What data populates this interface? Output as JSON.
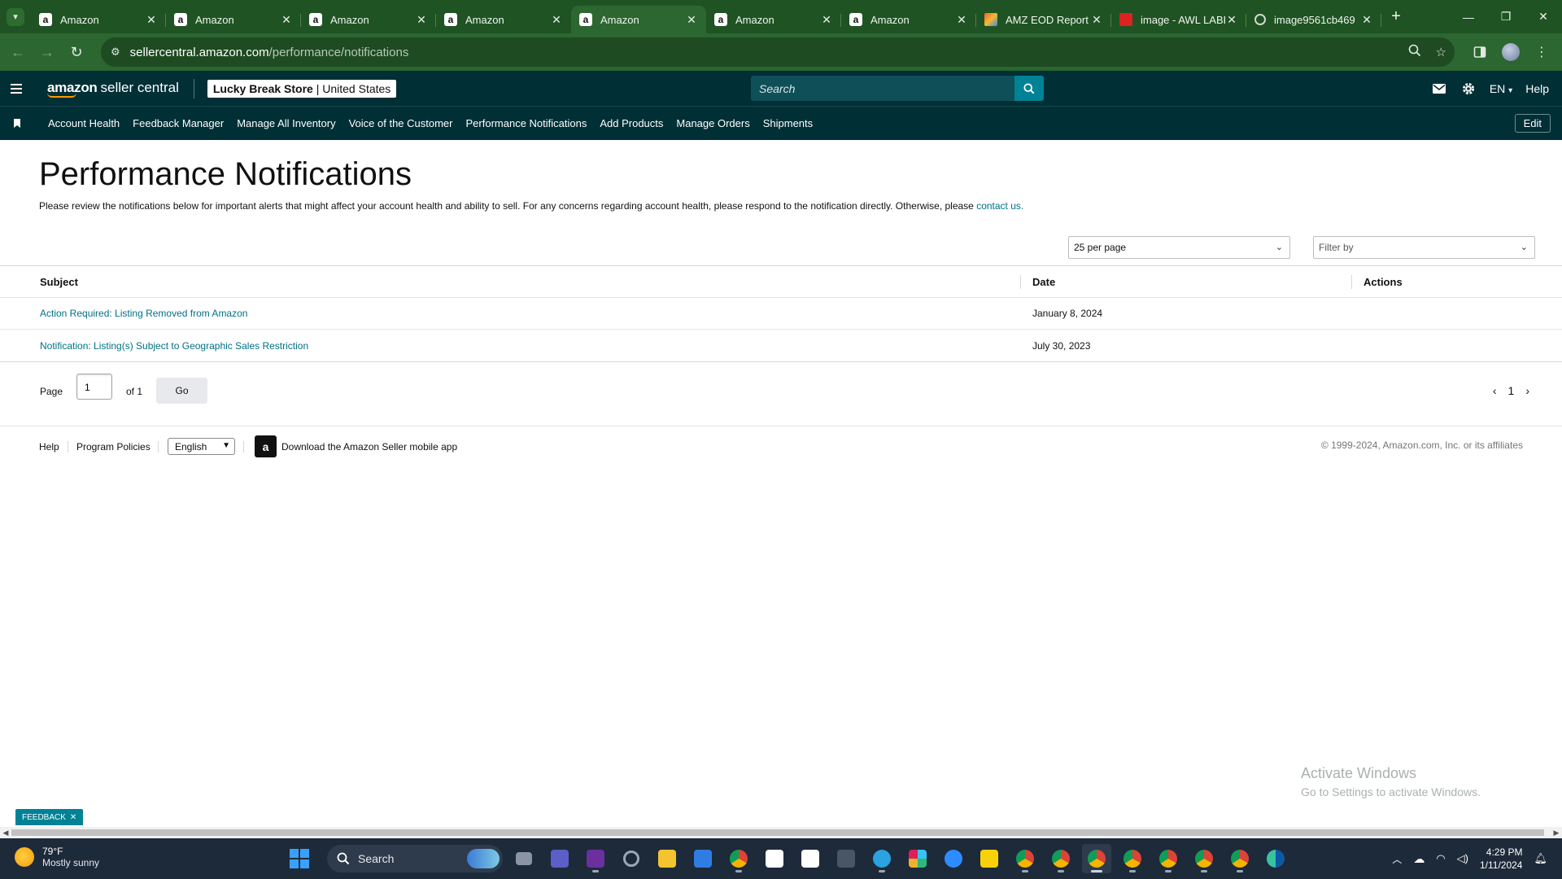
{
  "browser": {
    "tabs": [
      {
        "title": "Amazon",
        "favicon": "amazon-icon",
        "active": false
      },
      {
        "title": "Amazon",
        "favicon": "amazon-icon",
        "active": false
      },
      {
        "title": "Amazon",
        "favicon": "amazon-icon",
        "active": false
      },
      {
        "title": "Amazon",
        "favicon": "amazon-icon",
        "active": false
      },
      {
        "title": "Amazon",
        "favicon": "amazon-icon",
        "active": true
      },
      {
        "title": "Amazon",
        "favicon": "amazon-icon",
        "active": false
      },
      {
        "title": "Amazon",
        "favicon": "amazon-icon",
        "active": false
      },
      {
        "title": "AMZ EOD Report",
        "favicon": "report-icon",
        "active": false
      },
      {
        "title": "image - AWL LABE",
        "favicon": "image-icon",
        "active": false
      },
      {
        "title": "image9561cb469",
        "favicon": "globe-icon",
        "active": false
      }
    ],
    "url_host": "sellercentral.amazon.com",
    "url_path": "/performance/notifications"
  },
  "header": {
    "logo_bold": "amazon",
    "logo_rest": "seller central",
    "store_name": "Lucky Break Store",
    "store_region": "United States",
    "search_placeholder": "Search",
    "language": "EN",
    "help": "Help"
  },
  "subnav": {
    "links": [
      "Account Health",
      "Feedback Manager",
      "Manage All Inventory",
      "Voice of the Customer",
      "Performance Notifications",
      "Add Products",
      "Manage Orders",
      "Shipments"
    ],
    "edit_label": "Edit"
  },
  "page": {
    "title": "Performance Notifications",
    "description": "Please review the notifications below for important alerts that might affect your account health and ability to sell. For any concerns regarding account health, please respond to the notification directly. Otherwise, please ",
    "contact_link": "contact us.",
    "per_page_select": "25 per page",
    "filter_select": "Filter by"
  },
  "table": {
    "headers": {
      "subject": "Subject",
      "date": "Date",
      "actions": "Actions"
    },
    "rows": [
      {
        "subject": "Action Required: Listing Removed from Amazon",
        "date": "January 8, 2024"
      },
      {
        "subject": "Notification: Listing(s) Subject to Geographic Sales Restriction",
        "date": "July 30, 2023"
      }
    ]
  },
  "pagination": {
    "page_label": "Page",
    "current_page": "1",
    "of_label": "of 1",
    "go_label": "Go",
    "nav_page": "1"
  },
  "footer": {
    "help": "Help",
    "program_policies": "Program Policies",
    "language": "English",
    "download_app": "Download the Amazon Seller mobile app",
    "copyright": "© 1999-2024, Amazon.com, Inc. or its affiliates"
  },
  "overlay": {
    "activate_title": "Activate Windows",
    "activate_sub": "Go to Settings to activate Windows.",
    "feedback": "FEEDBACK"
  },
  "taskbar": {
    "temperature": "79°F",
    "weather": "Mostly sunny",
    "search": "Search",
    "time": "4:29 PM",
    "date": "1/11/2024"
  },
  "colors": {
    "browser_frame": "#1f5323",
    "seller_header": "#002f36",
    "link": "#007185",
    "accent": "#008296"
  }
}
